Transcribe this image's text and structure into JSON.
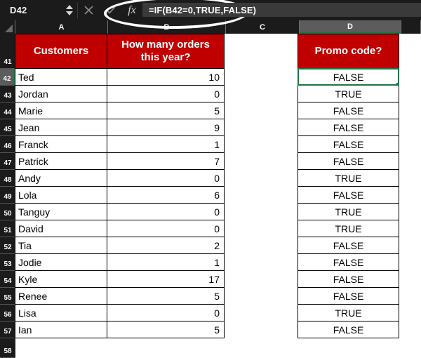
{
  "formula_bar": {
    "name_box_value": "D42",
    "cancel_icon": "x-icon",
    "confirm_icon": "check-icon",
    "fx_label": "fx",
    "formula_value": "=IF(B42=0,TRUE,FALSE)",
    "annotation": "white-ellipse-highlight"
  },
  "columns": [
    {
      "label": "A",
      "selected": false
    },
    {
      "label": "B",
      "selected": false
    },
    {
      "label": "C",
      "selected": false
    },
    {
      "label": "D",
      "selected": true
    }
  ],
  "table": {
    "header_row_number": "41",
    "headers": {
      "a": "Customers",
      "b_line1": "How many orders",
      "b_line2": "this year?",
      "c": "",
      "d": "Promo code?"
    },
    "rows": [
      {
        "row": "42",
        "customer": "Ted",
        "orders": "10",
        "promo": "FALSE",
        "selected": true
      },
      {
        "row": "43",
        "customer": "Jordan",
        "orders": "0",
        "promo": "TRUE",
        "selected": false
      },
      {
        "row": "44",
        "customer": "Marie",
        "orders": "5",
        "promo": "FALSE",
        "selected": false
      },
      {
        "row": "45",
        "customer": "Jean",
        "orders": "9",
        "promo": "FALSE",
        "selected": false
      },
      {
        "row": "46",
        "customer": "Franck",
        "orders": "1",
        "promo": "FALSE",
        "selected": false
      },
      {
        "row": "47",
        "customer": "Patrick",
        "orders": "7",
        "promo": "FALSE",
        "selected": false
      },
      {
        "row": "48",
        "customer": "Andy",
        "orders": "0",
        "promo": "TRUE",
        "selected": false
      },
      {
        "row": "49",
        "customer": "Lola",
        "orders": "6",
        "promo": "FALSE",
        "selected": false
      },
      {
        "row": "50",
        "customer": "Tanguy",
        "orders": "0",
        "promo": "TRUE",
        "selected": false
      },
      {
        "row": "51",
        "customer": "David",
        "orders": "0",
        "promo": "TRUE",
        "selected": false
      },
      {
        "row": "52",
        "customer": "Tia",
        "orders": "2",
        "promo": "FALSE",
        "selected": false
      },
      {
        "row": "53",
        "customer": "Jodie",
        "orders": "1",
        "promo": "FALSE",
        "selected": false
      },
      {
        "row": "54",
        "customer": "Kyle",
        "orders": "17",
        "promo": "FALSE",
        "selected": false
      },
      {
        "row": "55",
        "customer": "Renee",
        "orders": "5",
        "promo": "FALSE",
        "selected": false
      },
      {
        "row": "56",
        "customer": "Lisa",
        "orders": "0",
        "promo": "TRUE",
        "selected": false
      },
      {
        "row": "57",
        "customer": "Ian",
        "orders": "5",
        "promo": "FALSE",
        "selected": false
      }
    ],
    "trailing_row_number": "58"
  },
  "colors": {
    "header_red": "#C00000",
    "selection_green": "#217346",
    "chrome_dark": "#1b1b1b",
    "header_selected_gray": "#5c5c5c"
  }
}
